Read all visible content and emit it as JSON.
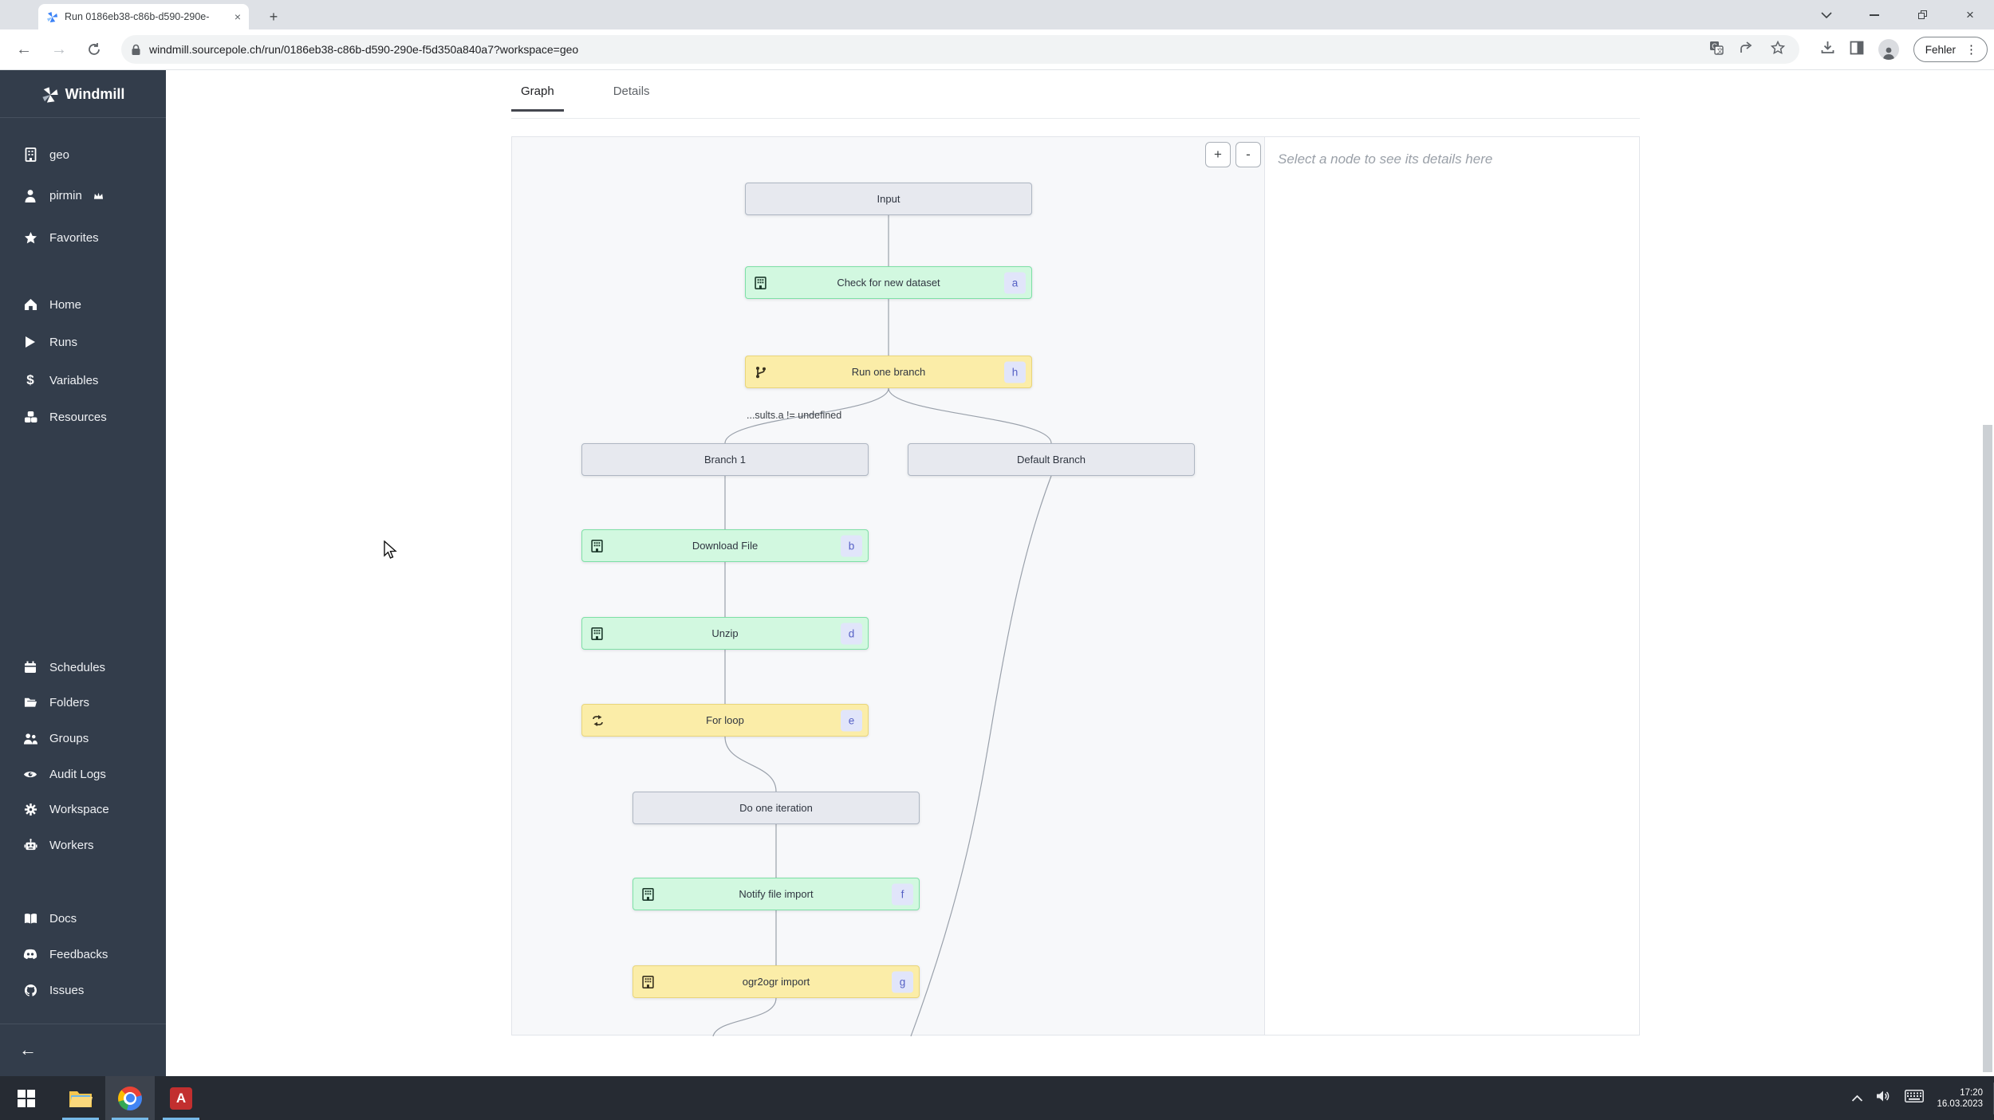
{
  "browser": {
    "tab_title": "Run 0186eb38-c86b-d590-290e-",
    "tab_close": "×",
    "new_tab": "+",
    "back": "←",
    "forward": "→",
    "url": "windmill.sourcepole.ch/run/0186eb38-c86b-d590-290e-f5d350a840a7?workspace=geo",
    "error_button_label": "Fehler",
    "kebab": "⋮",
    "close_window": "×"
  },
  "sidebar": {
    "brand": "Windmill",
    "nav_top": [
      {
        "label": "geo",
        "icon": "building-icon"
      },
      {
        "label": "pirmin",
        "icon": "user-icon",
        "suffix_icon": "crown-icon"
      },
      {
        "label": "Favorites",
        "icon": "star-icon"
      }
    ],
    "nav_main": [
      {
        "label": "Home",
        "icon": "home-icon"
      },
      {
        "label": "Runs",
        "icon": "play-icon"
      },
      {
        "label": "Variables",
        "icon": "dollar-icon",
        "dollar": "$"
      },
      {
        "label": "Resources",
        "icon": "cubes-icon"
      }
    ],
    "nav_admin": [
      {
        "label": "Schedules",
        "icon": "calendar-icon"
      },
      {
        "label": "Folders",
        "icon": "folder-icon"
      },
      {
        "label": "Groups",
        "icon": "people-icon"
      },
      {
        "label": "Audit Logs",
        "icon": "eye-icon"
      },
      {
        "label": "Workspace",
        "icon": "gear-icon"
      },
      {
        "label": "Workers",
        "icon": "robot-icon"
      }
    ],
    "nav_links": [
      {
        "label": "Docs",
        "icon": "book-icon"
      },
      {
        "label": "Feedbacks",
        "icon": "discord-icon"
      },
      {
        "label": "Issues",
        "icon": "github-icon"
      }
    ],
    "back_arrow": "←"
  },
  "main": {
    "tabs": [
      {
        "label": "Graph",
        "active": true
      },
      {
        "label": "Details",
        "active": false
      }
    ],
    "zoom_in": "+",
    "zoom_out": "-",
    "details_placeholder": "Select a node to see its details here",
    "condition_label": "...sults.a != undefined"
  },
  "flow_nodes": [
    {
      "label": "Input",
      "type": "plain"
    },
    {
      "label": "Check for new dataset",
      "badge": "a",
      "type": "success",
      "icon": "building-icon"
    },
    {
      "label": "Run one branch",
      "badge": "h",
      "type": "warning",
      "icon": "branch-icon"
    },
    {
      "label": "Branch 1",
      "type": "plain"
    },
    {
      "label": "Default Branch",
      "type": "plain"
    },
    {
      "label": "Download File",
      "badge": "b",
      "type": "success",
      "icon": "building-icon"
    },
    {
      "label": "Unzip",
      "badge": "d",
      "type": "success",
      "icon": "building-icon"
    },
    {
      "label": "For loop",
      "badge": "e",
      "type": "warning",
      "icon": "loop-icon"
    },
    {
      "label": "Do one iteration",
      "type": "plain"
    },
    {
      "label": "Notify file import",
      "badge": "f",
      "type": "success",
      "icon": "building-icon"
    },
    {
      "label": "ogr2ogr import",
      "badge": "g",
      "type": "warning",
      "icon": "building-icon"
    }
  ],
  "taskbar": {
    "time": "17:20",
    "date": "16.03.2023",
    "acrobat_glyph": "A"
  },
  "colors": {
    "sidebar_bg": "#333d4b",
    "node_success_bg": "#d2f8e0",
    "node_success_border": "#7ee0a6",
    "node_warning_bg": "#fbeda8",
    "node_warning_border": "#e9d57a",
    "node_plain_bg": "#e7e9ef",
    "badge_bg": "#e1e5fa",
    "badge_text": "#5661c5",
    "taskbar_bg": "#262b33",
    "taskbar_accent": "#76b9e8",
    "titlebar_bg": "#dee1e6"
  }
}
